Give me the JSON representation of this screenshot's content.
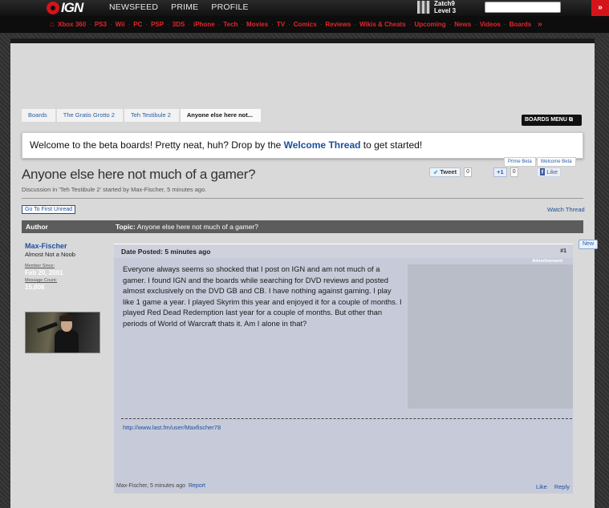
{
  "topbar": {
    "logo_text": "IGN",
    "nav": [
      "NEWSFEED",
      "PRIME",
      "PROFILE"
    ],
    "user": {
      "name": "Zatch9",
      "level": "Level 3"
    },
    "menu_glyph": "»"
  },
  "subnav": {
    "items": [
      "Xbox 360",
      "PS3",
      "Wii",
      "PC",
      "PSP",
      "3DS",
      "iPhone",
      "Tech",
      "Movies",
      "TV",
      "Comics",
      "Reviews",
      "Wikis & Cheats",
      "Upcoming",
      "News",
      "Videos",
      "Boards"
    ],
    "more_glyph": "»"
  },
  "breadcrumb": [
    "Boards",
    "The Gratis Grotto 2",
    "Teh Testibule 2",
    "Anyone else here not..."
  ],
  "boards_menu": "BOARDS MENU",
  "welcome": {
    "before": "Welcome to the beta boards! Pretty neat, huh? Drop by the ",
    "link": "Welcome Thread",
    "after": " to get started!"
  },
  "beta_tabs": [
    "Prime Beta",
    "Welcome Beta"
  ],
  "thread": {
    "title": "Anyone else here not much of a gamer?",
    "meta": "Discussion in 'Teh Testibule 2' started by Max-Fischer, 5 minutes ago."
  },
  "social": {
    "tweet": "Tweet",
    "tweet_count": "0",
    "plus": "+1",
    "plus_count": "0",
    "like": "Like"
  },
  "controls": {
    "first_unread": "Go To First Unread",
    "watch": "Watch Thread"
  },
  "header": {
    "author": "Author",
    "topic_label": "Topic:",
    "topic": "Anyone else here not much of a gamer?"
  },
  "author": {
    "name": "Max-Fischer",
    "title": "Almost Not a Noob",
    "member_since_label": "Member Since:",
    "member_since": "Feb 20, 2001",
    "message_count_label": "Message Count:",
    "message_count": "15,806"
  },
  "post": {
    "date": "Date Posted: 5 minutes ago",
    "number": "#1",
    "badge": "New",
    "ad_label": "Advertisement",
    "body": "Everyone always seems so shocked that I post on IGN and am not much of a gamer. I found IGN and the boards while searching for DVD reviews and posted almost exclusively on the DVD GB and CB. I have nothing against gaming. I play like 1 game a year. I played Skyrim this year and enjoyed it for a couple of months. I played Red Dead Redemption last year for a couple of months. But other than periods of World of Warcraft thats it. Am I alone in that?",
    "signature_link": "http://www.last.fm/user/Maxfischer78",
    "footer_meta": "Max-Fischer, 5 minutes ago",
    "report": "Report",
    "like": "Like",
    "reply": "Reply"
  },
  "colors": {
    "brand_red": "#d4141a",
    "link_blue": "#1c4f9c",
    "post_bg": "#c7cbd9"
  }
}
